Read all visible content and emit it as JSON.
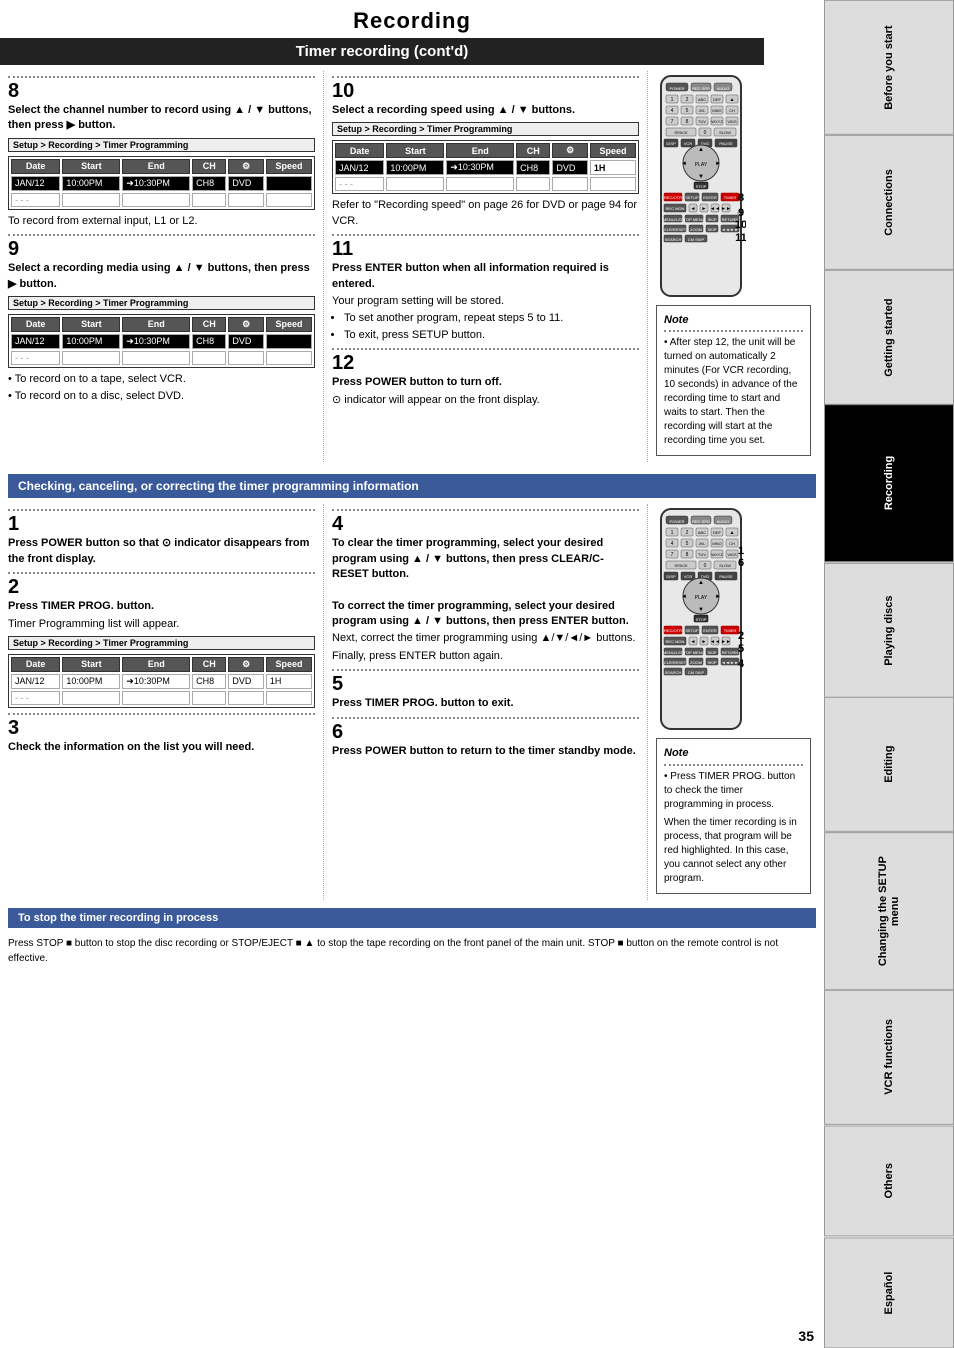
{
  "page": {
    "title": "Recording",
    "subtitle": "Timer recording (cont'd)",
    "page_number": "35"
  },
  "sidebar": {
    "tabs": [
      {
        "label": "Before you start",
        "active": false
      },
      {
        "label": "Connections",
        "active": false
      },
      {
        "label": "Getting started",
        "active": false
      },
      {
        "label": "Recording",
        "active": true
      },
      {
        "label": "Playing discs",
        "active": false
      },
      {
        "label": "Editing",
        "active": false
      },
      {
        "label": "Changing the SETUP menu",
        "active": false
      },
      {
        "label": "VCR functions",
        "active": false
      },
      {
        "label": "Others",
        "active": false
      },
      {
        "label": "Español",
        "active": false
      }
    ]
  },
  "top_section": {
    "step8": {
      "number": "8",
      "title": "Select the channel number to record using ▲ / ▼ buttons, then press ▶ button.",
      "setup_screen": {
        "title": "Setup > Recording > Timer Programming",
        "headers": [
          "Date",
          "Start",
          "End",
          "CH",
          "⚙",
          "Speed"
        ],
        "row1": [
          "JAN/12",
          "10:00PM",
          "➜10:30PM",
          "CH8",
          "DVD",
          ""
        ],
        "row2": [
          "- - -",
          "",
          "",
          "",
          "",
          ""
        ]
      },
      "note": "To record from external input, L1 or L2."
    },
    "step9": {
      "number": "9",
      "title": "Select a recording media using ▲ / ▼ buttons, then press ▶ button.",
      "setup_screen": {
        "title": "Setup > Recording > Timer Programming",
        "headers": [
          "Date",
          "Start",
          "End",
          "CH",
          "⚙",
          "Speed"
        ],
        "row1": [
          "JAN/12",
          "10:00PM",
          "➜10:30PM",
          "CH8",
          "DVD",
          ""
        ],
        "row2": [
          "- - -",
          "",
          "",
          "",
          "",
          ""
        ]
      },
      "notes": [
        "• To record on to a tape, select VCR.",
        "• To record on to a disc, select DVD."
      ]
    },
    "step10": {
      "number": "10",
      "title": "Select a recording speed using ▲ / ▼ buttons.",
      "setup_screen": {
        "title": "Setup > Recording > Timer Programming",
        "headers": [
          "Date",
          "Start",
          "End",
          "CH",
          "⚙",
          "Speed"
        ],
        "row1": [
          "JAN/12",
          "10:00PM",
          "➜10:30PM",
          "CH8",
          "DVD",
          "1H"
        ],
        "row2": [
          "- - -",
          "",
          "",
          "",
          "",
          ""
        ]
      },
      "note": "Refer to \"Recording speed\" on page 26 for DVD or page 94 for VCR."
    },
    "step11": {
      "number": "11",
      "title": "Press ENTER button when all information required is entered.",
      "body": "Your program setting will be stored.",
      "bullets": [
        "To set another program, repeat steps 5 to 11.",
        "To exit, press SETUP button."
      ]
    },
    "step12": {
      "number": "12",
      "title": "Press POWER button to turn off.",
      "body": "⊙ indicator will appear on the front display."
    },
    "note_box": {
      "title": "Note",
      "bullets": [
        "After step 12, the unit will be turned on automatically 2 minutes (For VCR recording, 10 seconds) in advance of the recording time to start and waits to start. Then the recording will start at the recording time you set."
      ]
    }
  },
  "checking_section": {
    "title": "Checking, canceling, or correcting the timer programming information",
    "step1": {
      "number": "1",
      "title": "Press POWER button so that ⊙ indicator disappears from the front display."
    },
    "step2": {
      "number": "2",
      "title": "Press TIMER PROG. button.",
      "body": "Timer Programming list will appear.",
      "setup_screen": {
        "title": "Setup > Recording > Timer Programming",
        "headers": [
          "Date",
          "Start",
          "End",
          "CH",
          "⚙",
          "Speed"
        ],
        "row1": [
          "JAN/12",
          "10:00PM",
          "➜10:30PM",
          "CH8",
          "DVD",
          "1H"
        ],
        "row2": [
          "- - -",
          "",
          "",
          "",
          "",
          ""
        ]
      }
    },
    "step3": {
      "number": "3",
      "title": "Check the information on the list you will need."
    },
    "step4": {
      "number": "4",
      "title": "To clear the timer programming, select your desired program using ▲ / ▼ buttons, then press CLEAR/C-RESET button.",
      "body2_title": "To correct the timer programming, select your desired program using ▲ / ▼ buttons, then press ENTER button.",
      "body2": "Next, correct the timer programming using ▲/▼/◄/► buttons.",
      "body3": "Finally, press ENTER button again."
    },
    "step5": {
      "number": "5",
      "title": "Press TIMER PROG. button to exit."
    },
    "step6": {
      "number": "6",
      "title": "Press POWER button to return to the timer standby mode."
    },
    "step_labels_right": [
      "1",
      "6",
      "2",
      "5",
      "4"
    ],
    "note_box2": {
      "title": "Note",
      "bullets": [
        "Press TIMER PROG. button to check the timer programming in process.",
        "When the timer recording is in process, that program will be red highlighted. In this case, you cannot select any other program."
      ]
    }
  },
  "stop_section": {
    "title": "To stop the timer recording in process",
    "body": "Press STOP ■ button to stop the disc recording or STOP/EJECT ■ ▲ to stop the tape recording on the front panel of the main unit. STOP ■ button on the remote control is not effective."
  }
}
